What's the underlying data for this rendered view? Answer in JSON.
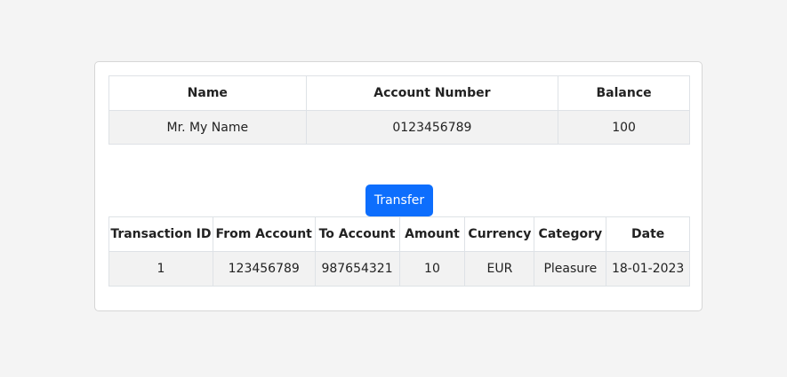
{
  "account_table": {
    "headers": [
      "Name",
      "Account Number",
      "Balance"
    ],
    "rows": [
      [
        "Mr. My Name",
        "0123456789",
        "100"
      ]
    ]
  },
  "transfer_button": {
    "label": "Transfer",
    "color": "#0d6efd"
  },
  "transactions_table": {
    "headers": [
      "Transaction ID",
      "From Account",
      "To Account",
      "Amount",
      "Currency",
      "Category",
      "Date"
    ],
    "rows": [
      [
        "1",
        "123456789",
        "987654321",
        "10",
        "EUR",
        "Pleasure",
        "18-01-2023"
      ]
    ]
  }
}
